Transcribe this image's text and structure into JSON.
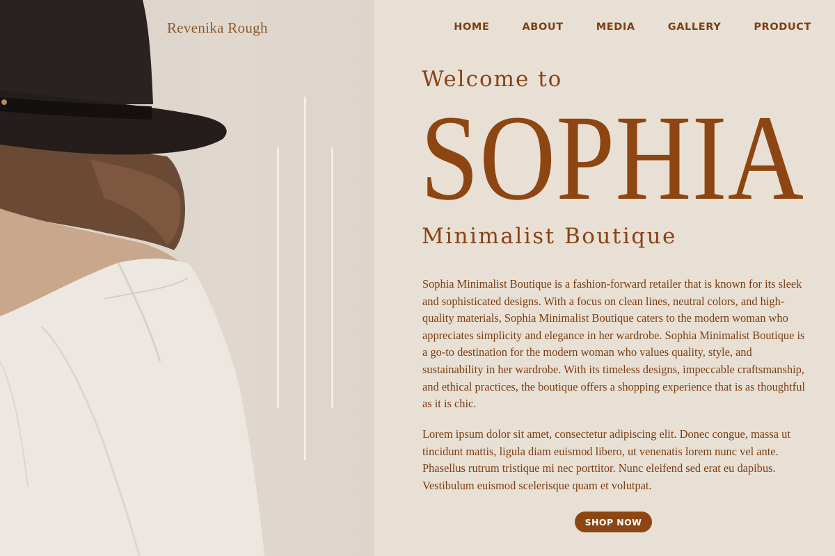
{
  "brand": {
    "logo_text": "Revenika Rough"
  },
  "nav": {
    "items": [
      "HOME",
      "ABOUT",
      "MEDIA",
      "GALLERY",
      "PRODUCT"
    ]
  },
  "hero": {
    "welcome": "Welcome to",
    "title": "SOPHIA",
    "subtitle": "Minimalist Boutique",
    "paragraph_1": "Sophia Minimalist Boutique is a fashion-forward retailer that is known for its sleek and sophisticated designs. With a focus on clean lines, neutral colors, and high-quality materials, Sophia Minimalist Boutique caters to the modern woman who appreciates simplicity and elegance in her wardrobe. Sophia Minimalist Boutique is a go-to destination for the modern woman who values quality, style, and sustainability in her wardrobe. With its timeless designs, impeccable craftsmanship, and ethical practices, the boutique offers a shopping experience that is as thoughtful as it is chic.",
    "paragraph_2": "Lorem ipsum dolor sit amet, consectetur adipiscing elit. Donec congue, massa ut tincidunt mattis, ligula diam euismod libero, ut venenatis lorem nunc vel ante. Phasellus rutrum tristique mi nec porttitor. Nunc eleifend sed erat eu dapibus. Vestibulum euismod scelerisque quam et volutpat.",
    "cta_label": "SHOP NOW"
  },
  "colors": {
    "accent": "#8d4612",
    "background": "#e8e0d4",
    "text": "#7c3d12"
  },
  "image": {
    "description_icon": "woman-in-hat-photo"
  }
}
